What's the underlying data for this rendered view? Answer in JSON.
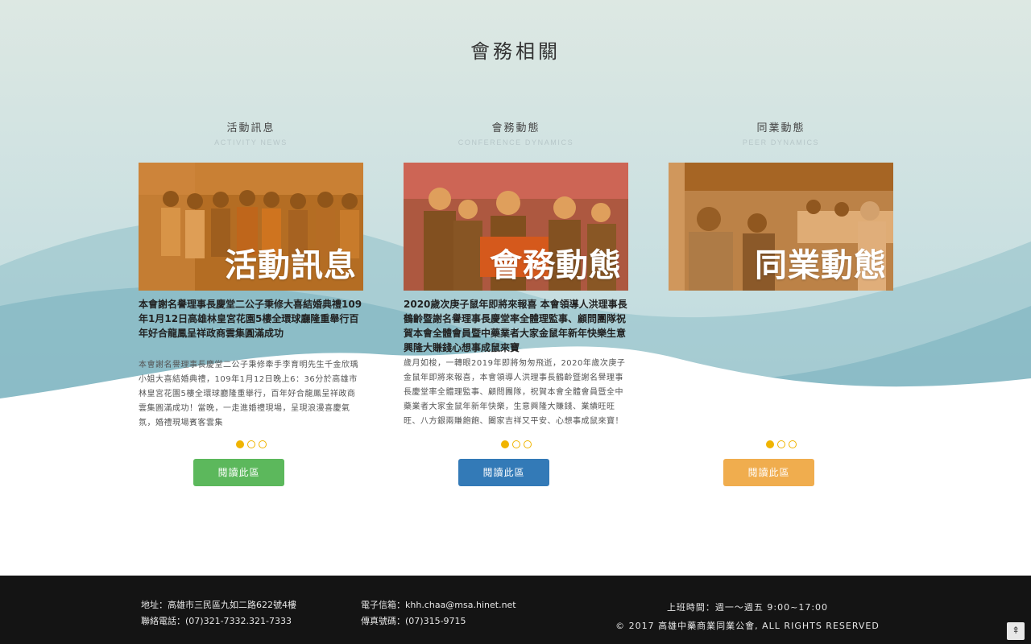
{
  "section": {
    "title": "會務相關"
  },
  "columns": [
    {
      "heading": "活動訊息",
      "heading_en": "ACTIVITY NEWS",
      "image_label": "活動訊息",
      "news_title": "本會謝名譽理事長慶堂二公子秉修大喜結婚典禮109年1月12日高雄林皇宮花園5樓全環球廳隆重舉行百年好合龍鳳呈祥政商雲集圓滿成功",
      "news_body": "本會謝名譽理事長慶堂二公子秉修牽手李育明先生千金欣瑀小姐大喜結婚典禮，109年1月12日晚上6：36分於高雄市林皇宮花園5樓全環球廳隆重舉行，百年好合龍鳳呈祥政商雲集圓滿成功！當晚，一走進婚禮現場，呈現浪漫喜慶氣氛，婚禮現場賓客雲集",
      "button": "閱讀此區",
      "button_color": "#5cb85c"
    },
    {
      "heading": "會務動態",
      "heading_en": "CONFERENCE DYNAMICS",
      "image_label": "會務動態",
      "news_title": "2020歲次庚子鼠年即將來報喜 本會領導人洪理事長鶴齡暨謝名譽理事長慶堂率全體理監事、顧問團隊祝賀本會全體會員暨中藥業者大家金鼠年新年快樂生意興隆大賺錢心想事成鼠來寶",
      "news_body": "歲月如梭，一轉眼2019年即將匆匆飛逝，2020年歲次庚子金鼠年即將來報喜，本會領導人洪理事長鶴齡暨謝名譽理事長慶堂率全體理監事、顧問團隊，祝賀本會全體會員暨全中藥業者大家金鼠年新年快樂，生意興隆大賺錢、業績旺旺旺、八方銀兩賺飽飽、闔家吉祥又平安、心想事成鼠來寶！恭喜！恭喜！",
      "button": "閱讀此區",
      "button_color": "#337ab7"
    },
    {
      "heading": "同業動態",
      "heading_en": "PEER DYNAMICS",
      "image_label": "同業動態",
      "news_title": "",
      "news_body": "",
      "button": "閱讀此區",
      "button_color": "#f0ad4e"
    }
  ],
  "carousel": {
    "arrow_prev": "‹",
    "arrow_next": "›"
  },
  "footer": {
    "address": "地址：高雄市三民區九如二路622號4樓",
    "phone": "聯絡電話：(07)321-7332.321-7333",
    "email": "電子信箱：khh.chaa@msa.hinet.net",
    "fax": "傳真號碼：(07)315-9715",
    "hours": "上班時間：週一～週五 9:00~17:00",
    "copyright": "© 2017 高雄中藥商業同業公會, ALL RIGHTS RESERVED",
    "back_to_top": "⇞"
  },
  "colors": {
    "overlay": "#d77b1e",
    "dot_active": "#f0b400",
    "footer_bg": "#141414"
  }
}
